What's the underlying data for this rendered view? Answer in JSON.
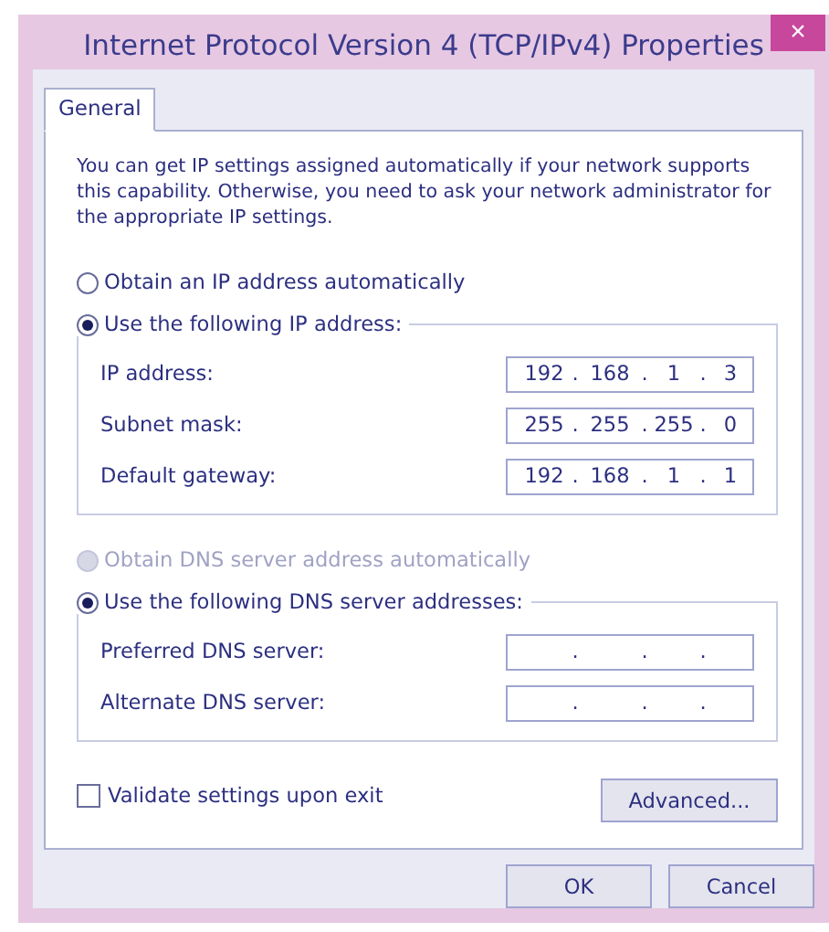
{
  "window": {
    "title": "Internet Protocol Version 4 (TCP/IPv4) Properties",
    "close": "×"
  },
  "tabs": [
    {
      "label": "General",
      "selected": true
    }
  ],
  "description": "You can get IP settings assigned automatically if your network supports this capability. Otherwise, you need to ask your network administrator for the appropriate IP settings.",
  "ip": {
    "auto": {
      "label": "Obtain an IP address automatically",
      "selected": false,
      "disabled": false
    },
    "manual": {
      "label": "Use the following IP address:",
      "selected": true,
      "disabled": false
    },
    "fields": [
      {
        "label": "IP address:",
        "octets": [
          "192",
          "168",
          "1",
          "3"
        ],
        "separators": [
          ".",
          ".",
          "."
        ]
      },
      {
        "label": "Subnet mask:",
        "octets": [
          "255",
          "255",
          "255",
          "0"
        ],
        "separators": [
          ".",
          ".",
          "."
        ]
      },
      {
        "label": "Default gateway:",
        "octets": [
          "192",
          "168",
          "1",
          "1"
        ],
        "separators": [
          ".",
          ".",
          "."
        ]
      }
    ]
  },
  "dns": {
    "auto": {
      "label": "Obtain DNS server address automatically",
      "selected": false,
      "disabled": true
    },
    "manual": {
      "label": "Use the following DNS server addresses:",
      "selected": true,
      "disabled": false
    },
    "fields": [
      {
        "label": "Preferred DNS server:",
        "separators": [
          ".",
          ".",
          "."
        ]
      },
      {
        "label": "Alternate DNS server:",
        "separators": [
          ".",
          ".",
          "."
        ]
      }
    ]
  },
  "validate": {
    "label": "Validate settings upon exit",
    "checked": false
  },
  "advanced_button": "Advanced...",
  "buttons": [
    "OK",
    "Cancel"
  ]
}
